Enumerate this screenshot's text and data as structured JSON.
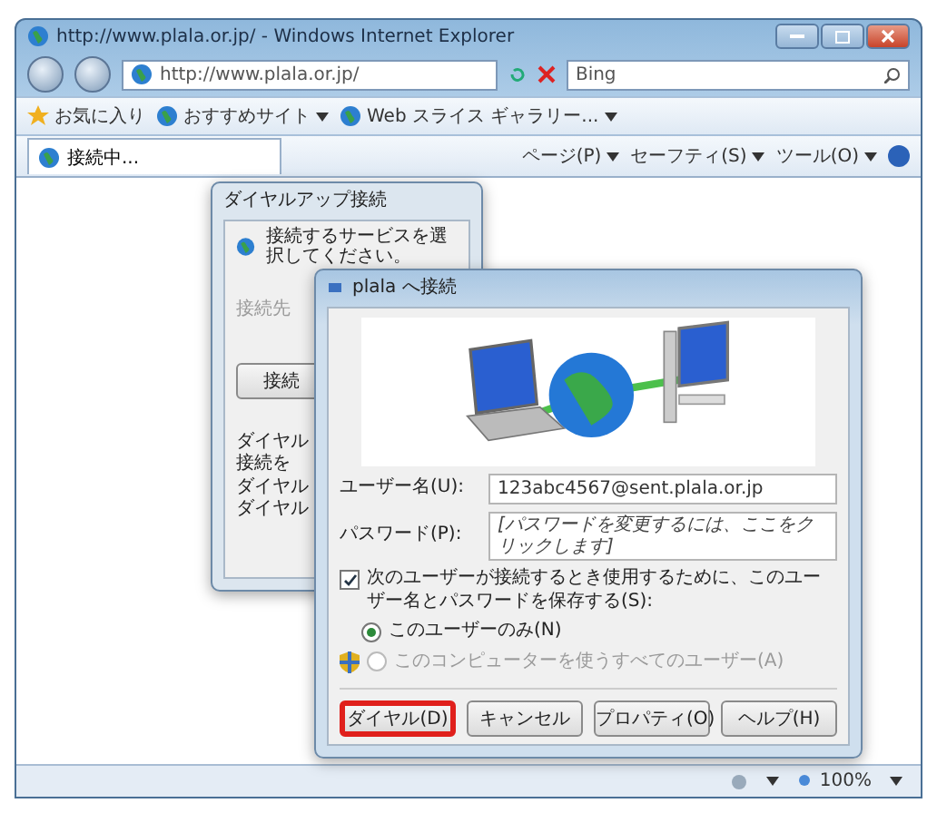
{
  "window": {
    "title": "http://www.plala.or.jp/ - Windows Internet Explorer"
  },
  "address_bar": {
    "value": "http://www.plala.or.jp/"
  },
  "search": {
    "value": "Bing"
  },
  "favorites_bar": [
    {
      "kind": "favorites",
      "label": "お気に入り"
    },
    {
      "kind": "menu",
      "label": "おすすめサイト"
    },
    {
      "kind": "menu",
      "label": "Web スライス ギャラリー..."
    }
  ],
  "tabs": [
    {
      "label": "接続中...",
      "selected": true
    }
  ],
  "command_bar": [
    "ページ(P)",
    "セーフティ(S)",
    "ツール(O)"
  ],
  "back_dialog": {
    "title": "ダイヤルアップ接続",
    "instruction": "接続するサービスを選択してください。",
    "field_label": "接続先",
    "button": "接続",
    "notes": [
      "ダイヤル",
      "接続を",
      "ダイヤル",
      "ダイヤル"
    ]
  },
  "dialog": {
    "title": "plala へ接続",
    "username_label": "ユーザー名(U):",
    "username": "123abc4567@sent.plala.or.jp",
    "password_label": "パスワード(P):",
    "password_placeholder": "[パスワードを変更するには、ここをクリックします]",
    "save": {
      "label": "次のユーザーが接続するとき使用するために、このユーザー名とパスワードを保存する(S):",
      "checked": true
    },
    "options": [
      {
        "label": "このユーザーのみ(N)",
        "selected": true,
        "disabled": false
      },
      {
        "label": "このコンピューターを使うすべてのユーザー(A)",
        "selected": false,
        "disabled": true
      }
    ],
    "buttons": [
      {
        "label": "ダイヤル(D)",
        "highlighted": true
      },
      {
        "label": "キャンセル",
        "highlighted": false
      },
      {
        "label": "プロパティ(O)",
        "highlighted": false
      },
      {
        "label": "ヘルプ(H)",
        "highlighted": false
      }
    ]
  },
  "status_bar": {
    "zoom": "100%"
  }
}
